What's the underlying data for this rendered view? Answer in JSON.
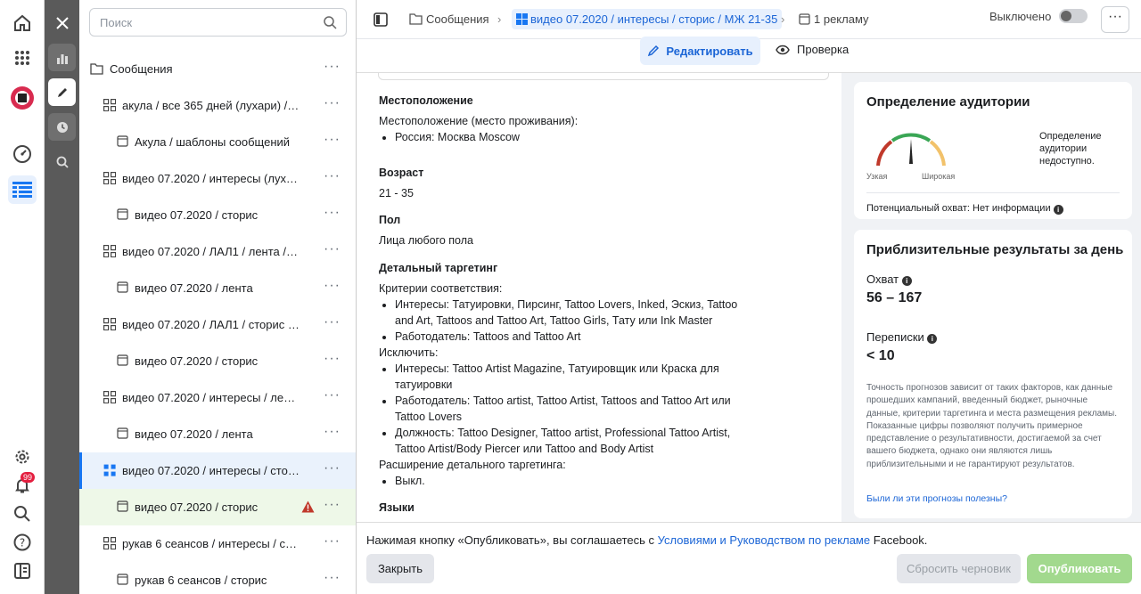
{
  "search": {
    "placeholder": "Поиск"
  },
  "tree": [
    {
      "label": "Сообщения",
      "type": "folder"
    },
    {
      "label": "акула / все 365 дней (лухари) / ле...",
      "type": "adset"
    },
    {
      "label": "Акула / шаблоны сообщений",
      "type": "ad"
    },
    {
      "label": "видео 07.2020 / интересы (лухар...",
      "type": "adset"
    },
    {
      "label": "видео 07.2020 / сторис",
      "type": "ad"
    },
    {
      "label": "видео 07.2020 / ЛАЛ1 / лента / М...",
      "type": "adset"
    },
    {
      "label": "видео 07.2020 / лента",
      "type": "ad"
    },
    {
      "label": "видео 07.2020 / ЛАЛ1 / сторис / ...",
      "type": "adset"
    },
    {
      "label": "видео 07.2020 / сторис",
      "type": "ad"
    },
    {
      "label": "видео 07.2020 / интересы / лента...",
      "type": "adset"
    },
    {
      "label": "видео 07.2020 / лента",
      "type": "ad"
    },
    {
      "label": "видео 07.2020 / интересы / стори...",
      "type": "adset-selected"
    },
    {
      "label": "видео 07.2020 / сторис",
      "type": "ad-warning"
    },
    {
      "label": "рукав 6 сеансов / интересы / стор...",
      "type": "adset"
    },
    {
      "label": "рукав 6 сеансов / сторис",
      "type": "ad"
    }
  ],
  "breadcrumb": {
    "campaign": "Сообщения",
    "adset": "видео 07.2020 / интересы / сторис / МЖ 21-35",
    "ads": "1 рекламу"
  },
  "toggle": {
    "label": "Выключено"
  },
  "tabs": {
    "edit": "Редактировать",
    "review": "Проверка"
  },
  "targeting": {
    "location_title": "Местоположение",
    "location_sub": "Местоположение (место проживания):",
    "location_items": [
      "Россия: Москва Moscow"
    ],
    "age_title": "Возраст",
    "age_value": "21 - 35",
    "gender_title": "Пол",
    "gender_value": "Лица любого пола",
    "detailed_title": "Детальный таргетинг",
    "match_sub": "Критерии соответствия:",
    "match_items": [
      "Интересы: Татуировки, Пирсинг, Tattoo Lovers, Inked, Эскиз, Tattoo and Art, Tattoos and Tattoo Art, Tattoo Girls, Тату или Ink Master",
      "Работодатель: Tattoos and Tattoo Art"
    ],
    "exclude_sub": "Исключить:",
    "exclude_items": [
      "Интересы: Tattoo Artist Magazine, Татуировщик или Краска для татуировки",
      "Работодатель: Tattoo artist, Tattoo Artist, Tattoos and Tattoo Art или Tattoo Lovers",
      "Должность: Tattoo Designer, Tattoo artist, Professional Tattoo Artist, Tattoo Artist/Body Piercer или Tattoo and Body Artist"
    ],
    "expansion_sub": "Расширение детального таргетинга:",
    "expansion_items": [
      "Выкл."
    ],
    "languages_title": "Языки"
  },
  "audience": {
    "title": "Определение аудитории",
    "narrow": "Узкая",
    "wide": "Широкая",
    "status": "Определение аудитории недоступно.",
    "reach_label": "Потенциальный охват: Нет информации"
  },
  "results": {
    "title": "Приблизительные результаты за день",
    "reach_label": "Охват",
    "reach_value": "56 – 167",
    "messages_label": "Переписки",
    "messages_value": "< 10",
    "note": "Точность прогнозов зависит от таких факторов, как данные прошедших кампаний, введенный бюджет, рыночные данные, критерии таргетинга и места размещения рекламы. Показанные цифры позволяют получить примерное представление о результативности, достигаемой за счет вашего бюджета, однако они являются лишь приблизительными и не гарантируют результатов.",
    "feedback": "Были ли эти прогнозы полезны?"
  },
  "footer": {
    "notice_pre": "Нажимая кнопку «Опубликовать», вы соглашаетесь с ",
    "notice_link": "Условиями и Руководством по рекламе",
    "notice_post": " Facebook.",
    "close": "Закрыть",
    "reset": "Сбросить черновик",
    "publish": "Опубликовать"
  },
  "notifications": {
    "count": "99"
  },
  "colors": {
    "accent": "#1877f2",
    "publish": "#a2d98e",
    "warning": "#c0392b"
  }
}
